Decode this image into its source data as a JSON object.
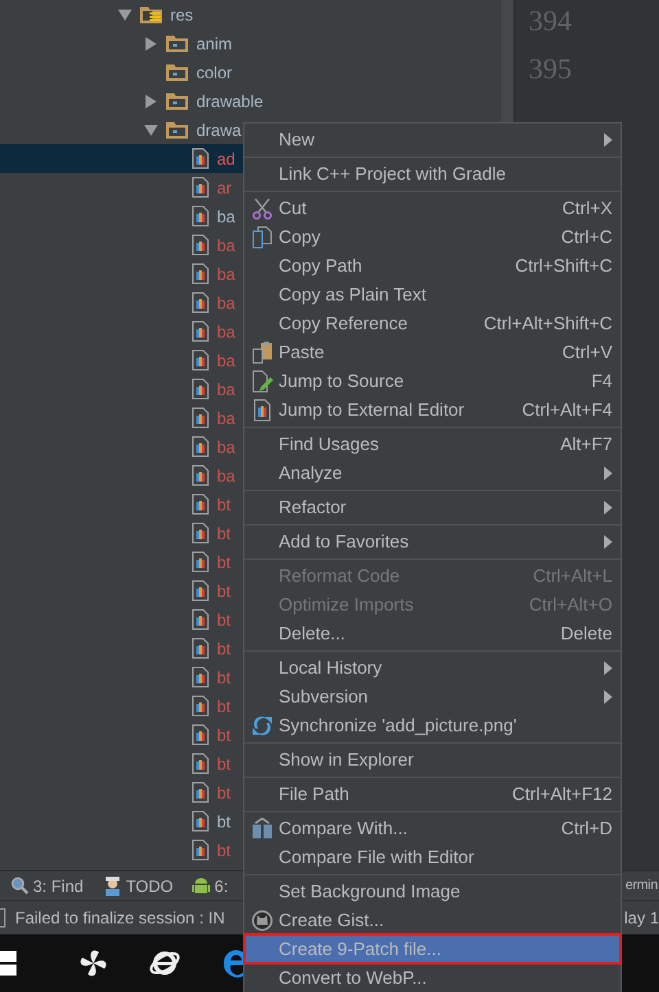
{
  "tree": {
    "items": [
      {
        "label": "res",
        "kind": "resources",
        "expanded": true,
        "selected": false,
        "children": [
          {
            "label": "anim",
            "kind": "folder",
            "expanded": false,
            "selected": false
          },
          {
            "label": "color",
            "kind": "folder",
            "selected": false
          },
          {
            "label": "drawable",
            "kind": "folder",
            "expanded": false,
            "selected": false
          },
          {
            "label": "drawa",
            "kind": "folder",
            "expanded": true,
            "selected": false,
            "children": [
              {
                "label": "ad",
                "kind": "file",
                "color": "#e05555",
                "selected": true
              },
              {
                "label": "ar",
                "kind": "file",
                "color": "#c75450",
                "selected": false
              },
              {
                "label": "ba",
                "kind": "file",
                "color": "#a9b7c6",
                "selected": false
              },
              {
                "label": "ba",
                "kind": "file",
                "color": "#c75450",
                "selected": false
              },
              {
                "label": "ba",
                "kind": "file",
                "color": "#c75450",
                "selected": false
              },
              {
                "label": "ba",
                "kind": "file",
                "color": "#c75450",
                "selected": false
              },
              {
                "label": "ba",
                "kind": "file",
                "color": "#c75450",
                "selected": false
              },
              {
                "label": "ba",
                "kind": "file",
                "color": "#c75450",
                "selected": false
              },
              {
                "label": "ba",
                "kind": "file",
                "color": "#c75450",
                "selected": false
              },
              {
                "label": "ba",
                "kind": "file",
                "color": "#c75450",
                "selected": false
              },
              {
                "label": "ba",
                "kind": "file",
                "color": "#c75450",
                "selected": false
              },
              {
                "label": "ba",
                "kind": "file",
                "color": "#c75450",
                "selected": false
              },
              {
                "label": "bt",
                "kind": "file",
                "color": "#c75450",
                "selected": false
              },
              {
                "label": "bt",
                "kind": "file",
                "color": "#c75450",
                "selected": false
              },
              {
                "label": "bt",
                "kind": "file",
                "color": "#c75450",
                "selected": false
              },
              {
                "label": "bt",
                "kind": "file",
                "color": "#c75450",
                "selected": false
              },
              {
                "label": "bt",
                "kind": "file",
                "color": "#c75450",
                "selected": false
              },
              {
                "label": "bt",
                "kind": "file",
                "color": "#c75450",
                "selected": false
              },
              {
                "label": "bt",
                "kind": "file",
                "color": "#c75450",
                "selected": false
              },
              {
                "label": "bt",
                "kind": "file",
                "color": "#c75450",
                "selected": false
              },
              {
                "label": "bt",
                "kind": "file",
                "color": "#c75450",
                "selected": false
              },
              {
                "label": "bt",
                "kind": "file",
                "color": "#c75450",
                "selected": false
              },
              {
                "label": "bt",
                "kind": "file",
                "color": "#c75450",
                "selected": false
              },
              {
                "label": "bt",
                "kind": "file",
                "color": "#a9b7c6",
                "selected": false
              },
              {
                "label": "bt",
                "kind": "file",
                "color": "#c75450",
                "selected": false
              }
            ]
          }
        ]
      }
    ]
  },
  "editor": {
    "line_numbers": [
      "394",
      "395"
    ]
  },
  "context_menu": {
    "items": [
      {
        "kind": "plain",
        "label": "New",
        "submenu": true,
        "selected": false
      },
      {
        "kind": "separator"
      },
      {
        "kind": "plain",
        "label": "Link C++ Project with Gradle",
        "selected": false
      },
      {
        "kind": "separator"
      },
      {
        "kind": "cut",
        "label": "Cut",
        "shortcut": "Ctrl+X",
        "selected": false
      },
      {
        "kind": "copy",
        "label": "Copy",
        "shortcut": "Ctrl+C",
        "selected": false
      },
      {
        "kind": "plain",
        "label": "Copy Path",
        "shortcut": "Ctrl+Shift+C",
        "selected": false
      },
      {
        "kind": "plain",
        "label": "Copy as Plain Text",
        "selected": false
      },
      {
        "kind": "plain",
        "label": "Copy Reference",
        "shortcut": "Ctrl+Alt+Shift+C",
        "selected": false
      },
      {
        "kind": "paste",
        "label": "Paste",
        "shortcut": "Ctrl+V",
        "selected": false
      },
      {
        "kind": "edit",
        "label": "Jump to Source",
        "shortcut": "F4",
        "selected": false
      },
      {
        "kind": "image",
        "label": "Jump to External Editor",
        "shortcut": "Ctrl+Alt+F4",
        "selected": false
      },
      {
        "kind": "separator"
      },
      {
        "kind": "plain",
        "label": "Find Usages",
        "shortcut": "Alt+F7",
        "selected": false
      },
      {
        "kind": "plain",
        "label": "Analyze",
        "submenu": true,
        "selected": false
      },
      {
        "kind": "separator"
      },
      {
        "kind": "plain",
        "label": "Refactor",
        "submenu": true,
        "selected": false
      },
      {
        "kind": "separator"
      },
      {
        "kind": "plain",
        "label": "Add to Favorites",
        "submenu": true,
        "selected": false
      },
      {
        "kind": "separator"
      },
      {
        "kind": "plain",
        "label": "Reformat Code",
        "shortcut": "Ctrl+Alt+L",
        "disabled": true,
        "selected": false
      },
      {
        "kind": "plain",
        "label": "Optimize Imports",
        "shortcut": "Ctrl+Alt+O",
        "disabled": true,
        "selected": false
      },
      {
        "kind": "plain",
        "label": "Delete...",
        "shortcut": "Delete",
        "selected": false
      },
      {
        "kind": "separator"
      },
      {
        "kind": "plain",
        "label": "Local History",
        "submenu": true,
        "selected": false
      },
      {
        "kind": "plain",
        "label": "Subversion",
        "submenu": true,
        "selected": false
      },
      {
        "kind": "sync",
        "label": "Synchronize 'add_picture.png'",
        "selected": false
      },
      {
        "kind": "separator"
      },
      {
        "kind": "plain",
        "label": "Show in Explorer",
        "selected": false
      },
      {
        "kind": "separator"
      },
      {
        "kind": "plain",
        "label": "File Path",
        "shortcut": "Ctrl+Alt+F12",
        "selected": false
      },
      {
        "kind": "separator"
      },
      {
        "kind": "compare",
        "label": "Compare With...",
        "shortcut": "Ctrl+D",
        "selected": false
      },
      {
        "kind": "plain",
        "label": "Compare File with Editor",
        "selected": false
      },
      {
        "kind": "separator"
      },
      {
        "kind": "plain",
        "label": "Set Background Image",
        "selected": false
      },
      {
        "kind": "gist",
        "label": "Create Gist...",
        "selected": false
      },
      {
        "kind": "plain",
        "label": "Create 9-Patch file...",
        "selected": true
      },
      {
        "kind": "plain",
        "label": "Convert to WebP...",
        "selected": false
      }
    ]
  },
  "tool_strip": {
    "items": [
      {
        "label": "3: Find",
        "kind": "search"
      },
      {
        "label": "TODO",
        "kind": "todo"
      },
      {
        "label": "6:",
        "kind": "android"
      }
    ],
    "right_label": "ermin"
  },
  "status_bar": {
    "message": "Failed to finalize session : IN",
    "right_text": "lay 1"
  }
}
